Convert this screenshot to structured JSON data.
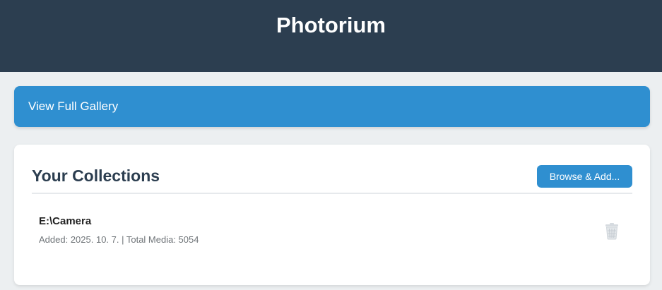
{
  "header": {
    "title": "Photorium"
  },
  "gallery_button": {
    "label": "View Full Gallery"
  },
  "collections": {
    "title": "Your Collections",
    "browse_label": "Browse & Add...",
    "items": [
      {
        "name": "E:\\Camera",
        "meta": "Added: 2025. 10. 7. | Total Media: 5054",
        "delete_icon": "trash-icon"
      }
    ]
  },
  "colors": {
    "header_bg": "#2c3e50",
    "accent": "#2f8fd0",
    "page_bg": "#eceff1",
    "card_bg": "#ffffff"
  }
}
